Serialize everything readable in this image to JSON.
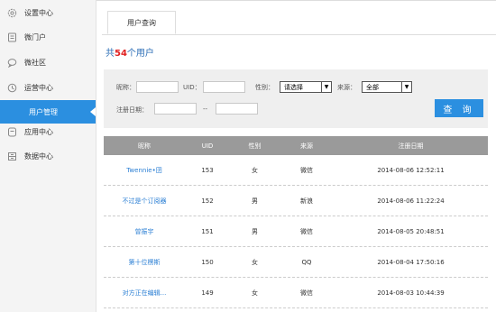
{
  "sidebar": {
    "items": [
      {
        "label": "设置中心",
        "icon": "gear-icon"
      },
      {
        "label": "微门户",
        "icon": "document-icon"
      },
      {
        "label": "微社区",
        "icon": "chat-icon"
      },
      {
        "label": "运营中心",
        "icon": "clock-icon"
      },
      {
        "label": "用户管理",
        "icon": "",
        "active": true
      },
      {
        "label": "应用中心",
        "icon": "app-icon"
      },
      {
        "label": "数据中心",
        "icon": "grid-icon"
      }
    ]
  },
  "tabs": [
    {
      "label": "用户查询"
    }
  ],
  "summary": {
    "prefix": "共",
    "count": "54",
    "suffix": "个用户"
  },
  "filter": {
    "nickname_label": "昵称：",
    "uid_label": "UID：",
    "gender_label": "性别：",
    "gender_value": "请选择",
    "source_label": "来源：",
    "source_value": "全部",
    "regdate_label": "注册日期：",
    "range_sep": "--",
    "query_button": "查 询"
  },
  "table": {
    "headers": [
      "昵称",
      "UID",
      "性别",
      "来源",
      "注册日期"
    ],
    "rows": [
      [
        "Twennie•囝",
        "153",
        "女",
        "微信",
        "2014-08-06 12:52:11"
      ],
      [
        "不过是个订阅器",
        "152",
        "男",
        "新浪",
        "2014-08-06 11:22:24"
      ],
      [
        "曾振宇",
        "151",
        "男",
        "微信",
        "2014-08-05 20:48:51"
      ],
      [
        "第十位楞斯",
        "150",
        "女",
        "QQ",
        "2014-08-04 17:50:16"
      ],
      [
        "对方正在编辑...",
        "149",
        "女",
        "微信",
        "2014-08-03 10:44:39"
      ]
    ]
  },
  "colors": {
    "accent": "#2b8fe0",
    "count": "#e02020",
    "header_bg": "#9a9a9a"
  }
}
